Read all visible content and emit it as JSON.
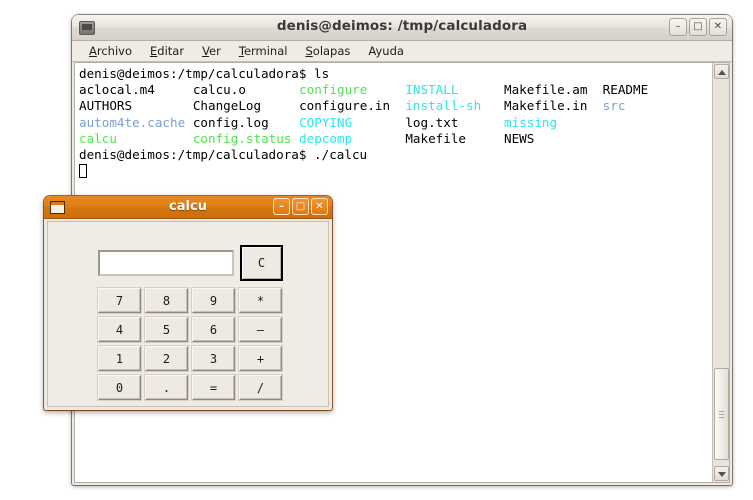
{
  "terminal": {
    "title": "denis@deimos: /tmp/calculadora",
    "app_icon": "terminal-icon",
    "window_buttons": [
      {
        "name": "minimize",
        "glyph": "–"
      },
      {
        "name": "maximize",
        "glyph": "□"
      },
      {
        "name": "close",
        "glyph": "✕"
      }
    ],
    "menu": [
      {
        "label": "Archivo",
        "mnemonic": "A"
      },
      {
        "label": "Editar",
        "mnemonic": "E"
      },
      {
        "label": "Ver",
        "mnemonic": "V"
      },
      {
        "label": "Terminal",
        "mnemonic": "T"
      },
      {
        "label": "Solapas",
        "mnemonic": "S"
      },
      {
        "label": "Ayuda",
        "mnemonic": ""
      }
    ],
    "prompt": "denis@deimos:/tmp/calculadora$",
    "lines": [
      {
        "type": "prompt",
        "prompt": "denis@deimos:/tmp/calculadora$",
        "command": " ls"
      },
      {
        "type": "listing",
        "cells": [
          {
            "text": "aclocal.m4",
            "color": "#000000"
          },
          {
            "text": "calcu.o",
            "color": "#000000"
          },
          {
            "text": "configure",
            "color": "#4ee44e"
          },
          {
            "text": "INSTALL",
            "color": "#2ee6e6"
          },
          {
            "text": "Makefile.am",
            "color": "#000000"
          },
          {
            "text": "README",
            "color": "#000000"
          }
        ]
      },
      {
        "type": "listing",
        "cells": [
          {
            "text": "AUTHORS",
            "color": "#000000"
          },
          {
            "text": "ChangeLog",
            "color": "#000000"
          },
          {
            "text": "configure.in",
            "color": "#000000"
          },
          {
            "text": "install-sh",
            "color": "#2ee6e6"
          },
          {
            "text": "Makefile.in",
            "color": "#000000"
          },
          {
            "text": "src",
            "color": "#7b9fd4"
          }
        ]
      },
      {
        "type": "listing",
        "cells": [
          {
            "text": "autom4te.cache",
            "color": "#7b9fd4"
          },
          {
            "text": "config.log",
            "color": "#000000"
          },
          {
            "text": "COPYING",
            "color": "#2ee6e6"
          },
          {
            "text": "log.txt",
            "color": "#000000"
          },
          {
            "text": "missing",
            "color": "#2ee6e6"
          },
          {
            "text": "",
            "color": "#000000"
          }
        ]
      },
      {
        "type": "listing",
        "cells": [
          {
            "text": "calcu",
            "color": "#4ee44e"
          },
          {
            "text": "config.status",
            "color": "#4ee44e"
          },
          {
            "text": "depcomp",
            "color": "#2ee6e6"
          },
          {
            "text": "Makefile",
            "color": "#000000"
          },
          {
            "text": "NEWS",
            "color": "#000000"
          },
          {
            "text": "",
            "color": "#000000"
          }
        ]
      },
      {
        "type": "prompt",
        "prompt": "denis@deimos:/tmp/calculadora$",
        "command": " ./calcu"
      },
      {
        "type": "cursor"
      }
    ],
    "scrollbar": {
      "up_arrow": "scroll-up-arrow",
      "down_arrow": "scroll-down-arrow",
      "thumb": "scroll-thumb"
    }
  },
  "calculator": {
    "title": "calcu",
    "app_icon": "window-icon",
    "window_buttons": [
      {
        "name": "minimize",
        "glyph": "–"
      },
      {
        "name": "maximize",
        "glyph": "□"
      },
      {
        "name": "close",
        "glyph": "✕"
      }
    ],
    "display_value": "",
    "clear_label": "C",
    "keys": [
      "7",
      "8",
      "9",
      "*",
      "4",
      "5",
      "6",
      "–",
      "1",
      "2",
      "3",
      "+",
      "0",
      ".",
      "=",
      "/"
    ]
  },
  "colors": {
    "calc_titlebar": "#e07f14",
    "term_titlebar": "#e9e5dd",
    "terminal_bg": "#ffffff",
    "dir_color": "#7b9fd4",
    "exec_color": "#4ee44e",
    "archive_color": "#2ee6e6"
  }
}
